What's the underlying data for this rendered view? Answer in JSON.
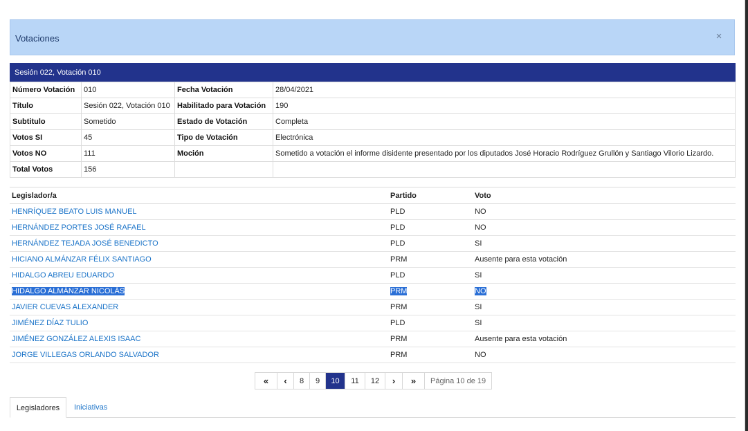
{
  "modal": {
    "title": "Votaciones",
    "close_label": "×"
  },
  "session": {
    "header": "Sesión 022, Votación 010"
  },
  "details": {
    "rows": [
      {
        "l1": "Número Votación",
        "v1": "010",
        "l2": "Fecha Votación",
        "v2": "28/04/2021"
      },
      {
        "l1": "Título",
        "v1": "Sesión 022, Votación 010",
        "l2": "Habilitado para Votación",
        "v2": "190"
      },
      {
        "l1": "Subtitulo",
        "v1": "Sometido",
        "l2": "Estado de Votación",
        "v2": "Completa"
      },
      {
        "l1": "Votos SI",
        "v1": "45",
        "l2": "Tipo de Votación",
        "v2": "Electrónica"
      },
      {
        "l1": "Votos NO",
        "v1": "111",
        "l2": "Moción",
        "v2": "Sometido a votación el informe disidente presentado por los diputados José Horacio Rodríguez Grullón y Santiago Vilorio Lizardo."
      },
      {
        "l1": "Total Votos",
        "v1": "156",
        "l2": "",
        "v2": ""
      }
    ]
  },
  "legislators": {
    "headers": {
      "name": "Legislador/a",
      "party": "Partido",
      "vote": "Voto"
    },
    "rows": [
      {
        "name": "HENRÍQUEZ BEATO LUIS MANUEL",
        "party": "PLD",
        "vote": "NO"
      },
      {
        "name": "HERNÁNDEZ PORTES JOSÉ RAFAEL",
        "party": "PLD",
        "vote": "NO"
      },
      {
        "name": "HERNÁNDEZ TEJADA JOSÉ BENEDICTO",
        "party": "PLD",
        "vote": "SI"
      },
      {
        "name": "HICIANO ALMÁNZAR FÉLIX SANTIAGO",
        "party": "PRM",
        "vote": "Ausente para esta votación"
      },
      {
        "name": "HIDALGO ABREU EDUARDO",
        "party": "PLD",
        "vote": "SI"
      },
      {
        "name": "HIDALGO ALMÁNZAR NICOLÁS",
        "party": "PRM",
        "vote": "NO"
      },
      {
        "name": "JAVIER CUEVAS ALEXANDER",
        "party": "PRM",
        "vote": "SI"
      },
      {
        "name": "JIMÉNEZ DÍAZ TULIO",
        "party": "PLD",
        "vote": "SI"
      },
      {
        "name": "JIMÉNEZ GONZÁLEZ ALEXIS ISAAC",
        "party": "PRM",
        "vote": "Ausente para esta votación"
      },
      {
        "name": "JORGE VILLEGAS ORLANDO SALVADOR",
        "party": "PRM",
        "vote": "NO"
      }
    ]
  },
  "pagination": {
    "first_icon": "«",
    "prev_icon": "‹",
    "pages": [
      "8",
      "9",
      "10",
      "11",
      "12"
    ],
    "current": "10",
    "next_icon": "›",
    "last_icon": "»",
    "info": "Página 10 de 19"
  },
  "tabs": {
    "legislators": "Legisladores",
    "initiatives": "Iniciativas"
  },
  "colors": {
    "header_bg": "#b9d6f7",
    "session_bar": "#22338c",
    "link": "#1a73c8",
    "selection": "#2a6fd6"
  }
}
